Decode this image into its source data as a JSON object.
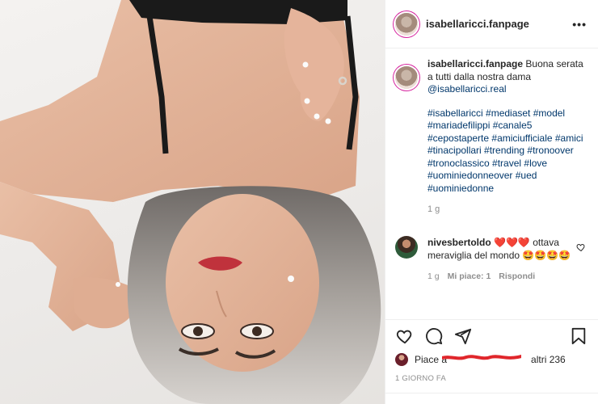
{
  "header": {
    "username": "isabellaricci.fanpage",
    "more_icon": "more-horizontal-icon"
  },
  "caption": {
    "username": "isabellaricci.fanpage",
    "text": "Buona serata a tutti dalla nostra dama",
    "mention": "@isabellaricci.real",
    "hashtags": "#isabellaricci #mediaset #model #mariadefilippi #canale5 #cepostaperte #amiciufficiale #amici #tinacipollari #trending #tronoover #tronoclassico #travel #love #uominiedonneover #ued #uominiedonne",
    "time": "1 g"
  },
  "comment": {
    "username": "nivesbertoldo",
    "text": "❤️❤️❤️ ottava meraviglia del mondo 🤩🤩🤩🤩",
    "time": "1 g",
    "likes": "Mi piace: 1",
    "reply": "Rispondi"
  },
  "actions": {
    "icons": [
      "heart-outline-icon",
      "comment-icon",
      "share-icon",
      "bookmark-icon"
    ]
  },
  "likes": {
    "text_visible_start": "Piace a",
    "text_visible_end": "altri 236"
  },
  "timestamp": "1 GIORNO FA",
  "colors": {
    "link": "#00376b",
    "muted": "#8e8e8e",
    "text": "#262626",
    "redaction": "#e0262b"
  }
}
